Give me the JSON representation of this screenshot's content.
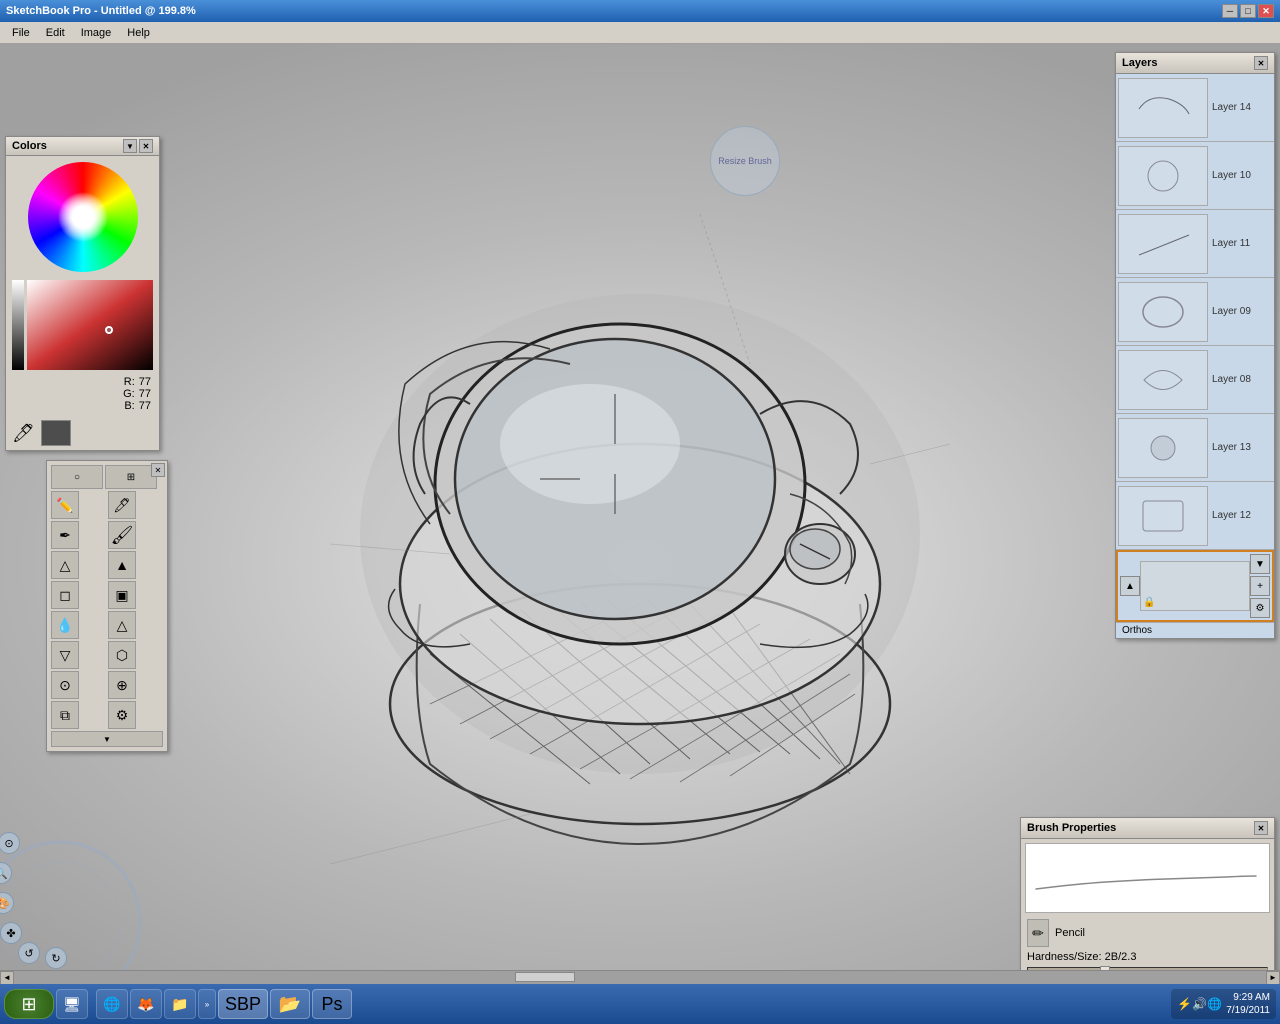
{
  "titlebar": {
    "title": "SketchBook Pro - Untitled @ 199.8%",
    "controls": [
      "minimize",
      "maximize",
      "close"
    ]
  },
  "menubar": {
    "items": [
      "File",
      "Edit",
      "Image",
      "Help"
    ]
  },
  "colors_panel": {
    "title": "Colors",
    "r": 77,
    "g": 77,
    "b": 77,
    "r_label": "R:",
    "g_label": "G:",
    "b_label": "B:"
  },
  "layers_panel": {
    "title": "Layers",
    "layers": [
      {
        "name": "Layer 14",
        "has_sketch": true
      },
      {
        "name": "Layer 10",
        "has_sketch": true
      },
      {
        "name": "Layer 11",
        "has_sketch": true
      },
      {
        "name": "Layer 09",
        "has_sketch": true
      },
      {
        "name": "Layer 08",
        "has_sketch": true
      },
      {
        "name": "Layer 13",
        "has_sketch": true
      },
      {
        "name": "Layer 12",
        "has_sketch": true
      }
    ],
    "active_layer": "Orthos",
    "active_layer_locked": true
  },
  "brush_properties": {
    "title": "Brush Properties",
    "brush_name": "Pencil",
    "hardness_label": "Hardness/Size: 2B/2.3"
  },
  "pressure_brush": {
    "label": "Resize Brush"
  },
  "taskbar": {
    "time": "9:29 AM",
    "date": "7/19/2011"
  }
}
